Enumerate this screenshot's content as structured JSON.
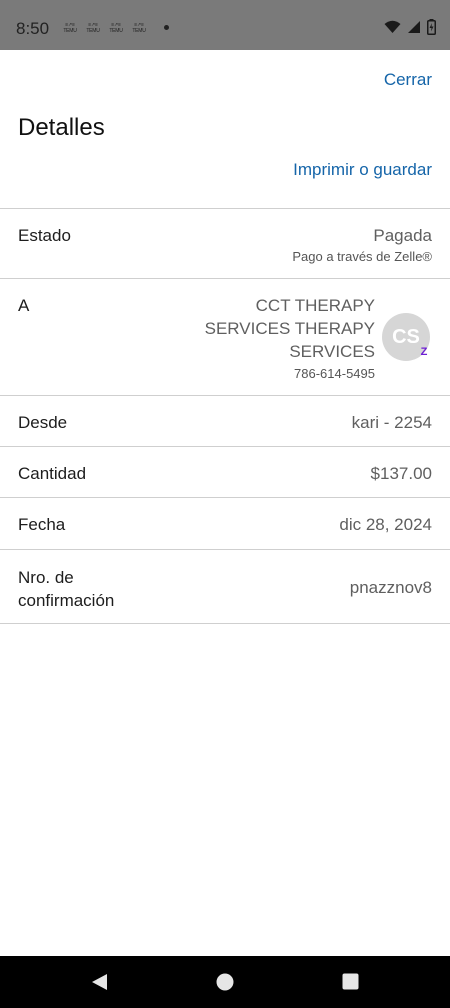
{
  "status_bar": {
    "time": "8:50",
    "notification_icons": [
      "TEMU",
      "TEMU",
      "TEMU",
      "TEMU"
    ]
  },
  "header": {
    "close_label": "Cerrar",
    "title": "Detalles",
    "print_label": "Imprimir o guardar"
  },
  "details": {
    "status": {
      "label": "Estado",
      "value": "Pagada",
      "sub": "Pago a través de Zelle®"
    },
    "to": {
      "label": "A",
      "name": "CCT THERAPY SERVICES THERAPY SERVICES",
      "phone": "786-614-5495",
      "avatar_initials": "CS",
      "badge": "Z"
    },
    "from": {
      "label": "Desde",
      "value": "kari - 2254"
    },
    "amount": {
      "label": "Cantidad",
      "value": "$137.00"
    },
    "date": {
      "label": "Fecha",
      "value": "dic 28, 2024"
    },
    "confirmation": {
      "label": "Nro. de confirmación",
      "value": "pnazznov8"
    }
  },
  "colors": {
    "link": "#1565a9",
    "zelle_badge": "#6d1ed4",
    "status_bar_bg": "#7a7a7a"
  },
  "icons": [
    "wifi-icon",
    "signal-icon",
    "battery-icon",
    "back-icon",
    "home-icon",
    "recents-icon"
  ]
}
